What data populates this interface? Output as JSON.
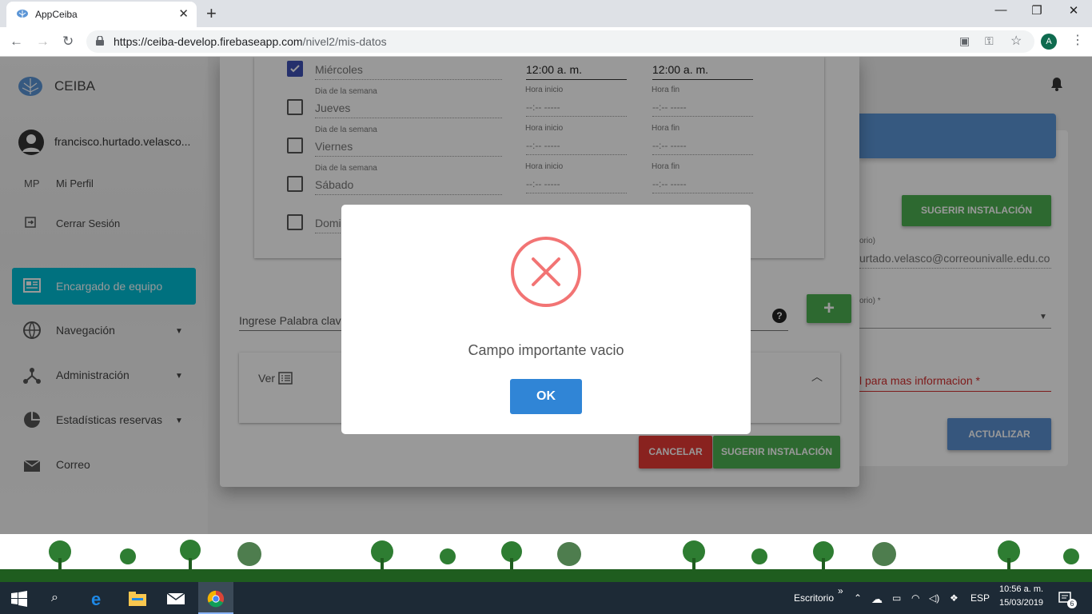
{
  "browser": {
    "tab_title": "AppCeiba",
    "new_tab": "+",
    "url_host": "https://ceiba-develop.firebaseapp.com",
    "url_path": "/nivel2/mis-datos",
    "profile_initial": "A",
    "window_controls": {
      "minimize": "—",
      "restore": "❐",
      "close": "✕"
    }
  },
  "sidebar": {
    "brand": "CEIBA",
    "user": "francisco.hurtado.velasco...",
    "profile_abbr": "MP",
    "profile_label": "Mi Perfil",
    "logout_label": "Cerrar Sesión",
    "active_item": "Encargado de equipo",
    "items": [
      {
        "label": "Navegación",
        "icon": "globe-icon",
        "dropdown": true
      },
      {
        "label": "Administración",
        "icon": "network-icon",
        "dropdown": true
      },
      {
        "label": "Estadísticas reservas",
        "icon": "pie-chart-icon",
        "dropdown": true
      },
      {
        "label": "Correo",
        "icon": "mail-icon",
        "dropdown": false
      }
    ]
  },
  "schedule": {
    "day_label": "Dia de la semana",
    "start_label": "Hora inicio",
    "end_label": "Hora fin",
    "empty_time": "--:-- -----",
    "rows": [
      {
        "day": "Miércoles",
        "checked": true,
        "start": "12:00 a. m.",
        "end": "12:00 a. m."
      },
      {
        "day": "Jueves",
        "checked": false
      },
      {
        "day": "Viernes",
        "checked": false
      },
      {
        "day": "Sábado",
        "checked": false
      },
      {
        "day": "Domi",
        "checked": false
      }
    ]
  },
  "search": {
    "placeholder": "Ingrese Palabra clave",
    "help": "?",
    "add": "+"
  },
  "ver_label": "Ver",
  "modal_buttons": {
    "cancel": "CANCELAR",
    "suggest": "SUGERIR INSTALACIÓN"
  },
  "right_panel": {
    "suggest_button": "SUGERIR INSTALACIÓN",
    "email_label": "orio)",
    "email_value": "urtado.velasco@correounivalle.edu.co",
    "select_label": "orio) *",
    "info_label": "l para mas informacion *",
    "update_button": "ACTUALIZAR"
  },
  "alert": {
    "message": "Campo importante vacio",
    "ok": "OK",
    "icon": "error-x-icon"
  },
  "taskbar": {
    "desktop_label": "Escritorio",
    "chevron": "»",
    "language": "ESP",
    "time": "10:56 a. m.",
    "date": "15/03/2019",
    "notifications": "6"
  },
  "colors": {
    "accent_active": "#00bcd4",
    "alert_error": "#f27474",
    "ok_button": "#3085d6",
    "green_button": "#4caf50",
    "cancel_button": "#e53935",
    "checkbox_checked": "#3f51b5"
  }
}
